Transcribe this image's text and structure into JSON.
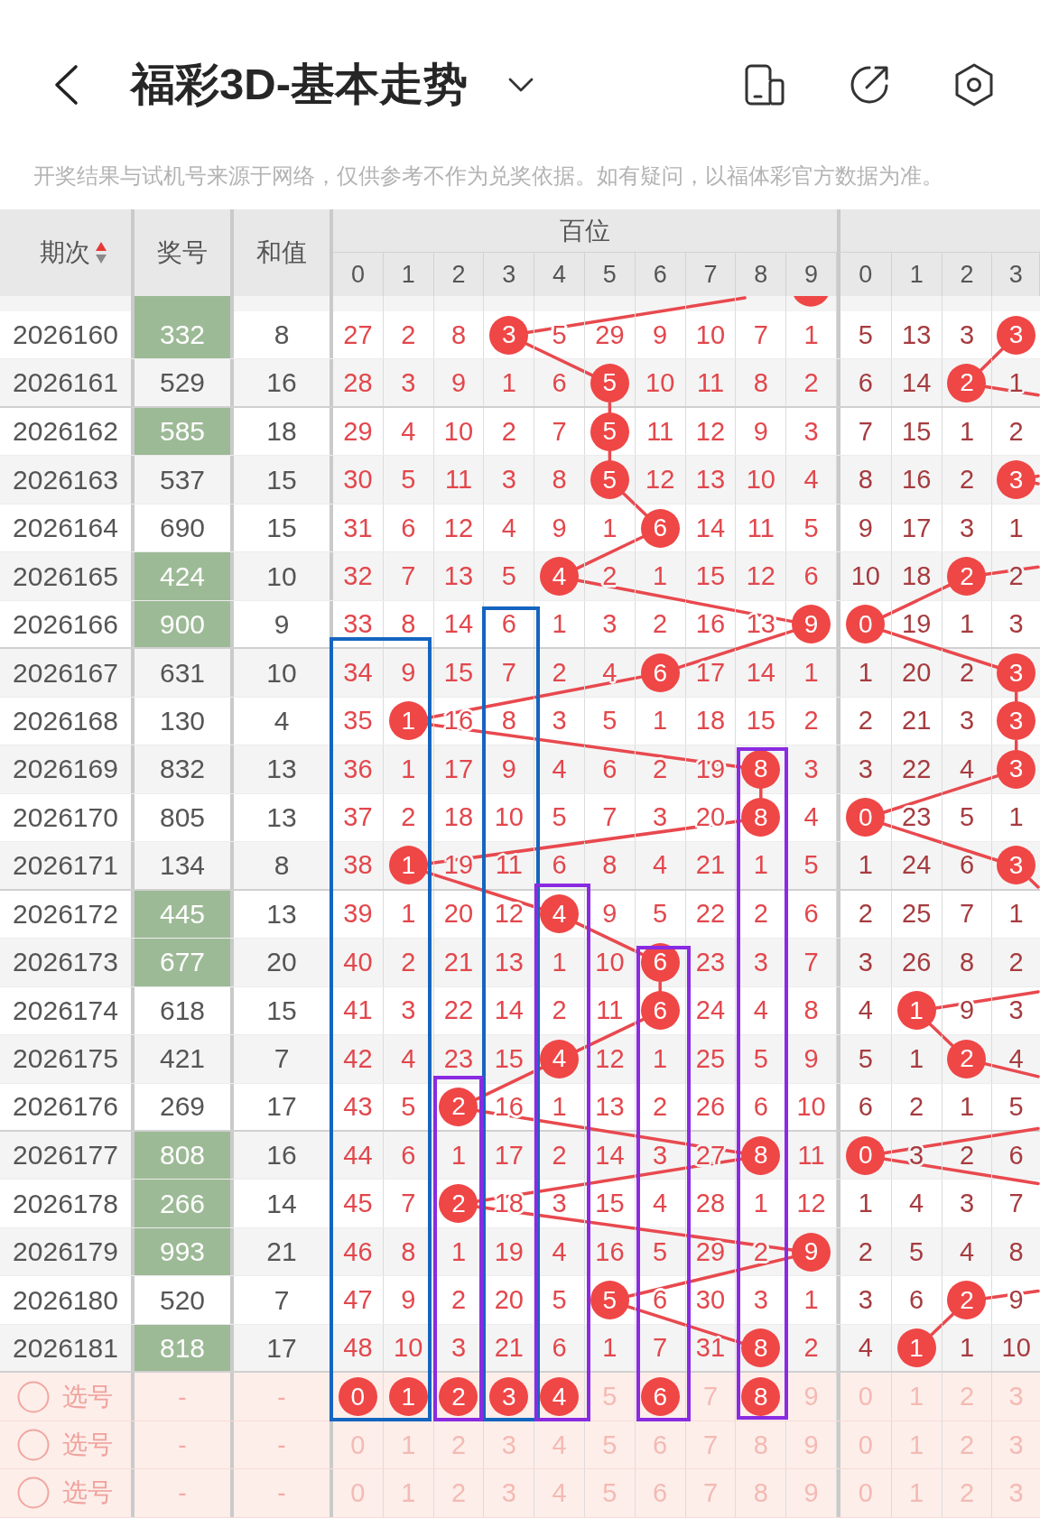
{
  "nav": {
    "title": "福彩3D-基本走势"
  },
  "notice": "开奖结果与试机号来源于网络，仅供参考不作为兑奖依据。如有疑问，以福体彩官方数据为准。",
  "table": {
    "columns": {
      "issue": "期次",
      "number": "奖号",
      "sum": "和值",
      "sort_ascending": true
    },
    "groups": [
      {
        "title": "百位",
        "digits": [
          "0",
          "1",
          "2",
          "3",
          "4",
          "5",
          "6",
          "7",
          "8",
          "9"
        ]
      },
      {
        "digits": [
          "0",
          "1",
          "2",
          "3"
        ]
      }
    ],
    "rows": [
      {
        "kind": "cut",
        "paired": true,
        "hundreds": [
          {
            "hit": false
          },
          {
            "hit": false
          },
          {
            "hit": false
          },
          {
            "hit": false
          },
          {
            "hit": false
          },
          {
            "hit": false
          },
          {
            "hit": false
          },
          {
            "hit": false
          },
          {
            "hit": false
          },
          {
            "hit": true
          }
        ]
      },
      {
        "kind": "draw",
        "issue": "2026160",
        "number": "332",
        "paired": true,
        "sum": "8",
        "hundreds": [
          {
            "text": "27",
            "hit": false
          },
          {
            "text": "2",
            "hit": false
          },
          {
            "text": "8",
            "hit": false
          },
          {
            "text": "3",
            "hit": true
          },
          {
            "text": "5",
            "hit": false
          },
          {
            "text": "29",
            "hit": false
          },
          {
            "text": "9",
            "hit": false
          },
          {
            "text": "10",
            "hit": false
          },
          {
            "text": "7",
            "hit": false
          },
          {
            "text": "1",
            "hit": false
          }
        ],
        "tens": [
          {
            "text": "5",
            "hit": false
          },
          {
            "text": "13",
            "hit": false
          },
          {
            "text": "3",
            "hit": false
          },
          {
            "text": "3",
            "hit": true
          }
        ]
      },
      {
        "kind": "draw",
        "issue": "2026161",
        "number": "529",
        "paired": false,
        "sum": "16",
        "hundreds": [
          {
            "text": "28",
            "hit": false
          },
          {
            "text": "3",
            "hit": false
          },
          {
            "text": "9",
            "hit": false
          },
          {
            "text": "1",
            "hit": false
          },
          {
            "text": "6",
            "hit": false
          },
          {
            "text": "5",
            "hit": true
          },
          {
            "text": "10",
            "hit": false
          },
          {
            "text": "11",
            "hit": false
          },
          {
            "text": "8",
            "hit": false
          },
          {
            "text": "2",
            "hit": false
          }
        ],
        "tens": [
          {
            "text": "6",
            "hit": false
          },
          {
            "text": "14",
            "hit": false
          },
          {
            "text": "2",
            "hit": true
          },
          {
            "text": "1",
            "hit": false
          }
        ]
      },
      {
        "kind": "draw",
        "issue": "2026162",
        "number": "585",
        "paired": true,
        "sum": "18",
        "hundreds": [
          {
            "text": "29",
            "hit": false
          },
          {
            "text": "4",
            "hit": false
          },
          {
            "text": "10",
            "hit": false
          },
          {
            "text": "2",
            "hit": false
          },
          {
            "text": "7",
            "hit": false
          },
          {
            "text": "5",
            "hit": true
          },
          {
            "text": "11",
            "hit": false
          },
          {
            "text": "12",
            "hit": false
          },
          {
            "text": "9",
            "hit": false
          },
          {
            "text": "3",
            "hit": false
          }
        ],
        "tens": [
          {
            "text": "7",
            "hit": false
          },
          {
            "text": "15",
            "hit": false
          },
          {
            "text": "1",
            "hit": false
          },
          {
            "text": "2",
            "hit": false
          }
        ]
      },
      {
        "kind": "draw",
        "issue": "2026163",
        "number": "537",
        "paired": false,
        "sum": "15",
        "hundreds": [
          {
            "text": "30",
            "hit": false
          },
          {
            "text": "5",
            "hit": false
          },
          {
            "text": "11",
            "hit": false
          },
          {
            "text": "3",
            "hit": false
          },
          {
            "text": "8",
            "hit": false
          },
          {
            "text": "5",
            "hit": true
          },
          {
            "text": "12",
            "hit": false
          },
          {
            "text": "13",
            "hit": false
          },
          {
            "text": "10",
            "hit": false
          },
          {
            "text": "4",
            "hit": false
          }
        ],
        "tens": [
          {
            "text": "8",
            "hit": false
          },
          {
            "text": "16",
            "hit": false
          },
          {
            "text": "2",
            "hit": false
          },
          {
            "text": "3",
            "hit": true
          }
        ]
      },
      {
        "kind": "draw",
        "issue": "2026164",
        "number": "690",
        "paired": false,
        "sum": "15",
        "hundreds": [
          {
            "text": "31",
            "hit": false
          },
          {
            "text": "6",
            "hit": false
          },
          {
            "text": "12",
            "hit": false
          },
          {
            "text": "4",
            "hit": false
          },
          {
            "text": "9",
            "hit": false
          },
          {
            "text": "1",
            "hit": false
          },
          {
            "text": "6",
            "hit": true
          },
          {
            "text": "14",
            "hit": false
          },
          {
            "text": "11",
            "hit": false
          },
          {
            "text": "5",
            "hit": false
          }
        ],
        "tens": [
          {
            "text": "9",
            "hit": false
          },
          {
            "text": "17",
            "hit": false
          },
          {
            "text": "3",
            "hit": false
          },
          {
            "text": "1",
            "hit": false
          }
        ]
      },
      {
        "kind": "draw",
        "issue": "2026165",
        "number": "424",
        "paired": true,
        "sum": "10",
        "hundreds": [
          {
            "text": "32",
            "hit": false
          },
          {
            "text": "7",
            "hit": false
          },
          {
            "text": "13",
            "hit": false
          },
          {
            "text": "5",
            "hit": false
          },
          {
            "text": "4",
            "hit": true
          },
          {
            "text": "2",
            "hit": false
          },
          {
            "text": "1",
            "hit": false
          },
          {
            "text": "15",
            "hit": false
          },
          {
            "text": "12",
            "hit": false
          },
          {
            "text": "6",
            "hit": false
          }
        ],
        "tens": [
          {
            "text": "10",
            "hit": false
          },
          {
            "text": "18",
            "hit": false
          },
          {
            "text": "2",
            "hit": true
          },
          {
            "text": "2",
            "hit": false
          }
        ]
      },
      {
        "kind": "draw",
        "issue": "2026166",
        "number": "900",
        "paired": true,
        "sum": "9",
        "hundreds": [
          {
            "text": "33",
            "hit": false
          },
          {
            "text": "8",
            "hit": false
          },
          {
            "text": "14",
            "hit": false
          },
          {
            "text": "6",
            "hit": false
          },
          {
            "text": "1",
            "hit": false
          },
          {
            "text": "3",
            "hit": false
          },
          {
            "text": "2",
            "hit": false
          },
          {
            "text": "16",
            "hit": false
          },
          {
            "text": "13",
            "hit": false
          },
          {
            "text": "9",
            "hit": true
          }
        ],
        "tens": [
          {
            "text": "0",
            "hit": true
          },
          {
            "text": "19",
            "hit": false
          },
          {
            "text": "1",
            "hit": false
          },
          {
            "text": "3",
            "hit": false
          }
        ]
      },
      {
        "kind": "draw",
        "issue": "2026167",
        "number": "631",
        "paired": false,
        "sum": "10",
        "hundreds": [
          {
            "text": "34",
            "hit": false
          },
          {
            "text": "9",
            "hit": false
          },
          {
            "text": "15",
            "hit": false
          },
          {
            "text": "7",
            "hit": false
          },
          {
            "text": "2",
            "hit": false
          },
          {
            "text": "4",
            "hit": false
          },
          {
            "text": "6",
            "hit": true
          },
          {
            "text": "17",
            "hit": false
          },
          {
            "text": "14",
            "hit": false
          },
          {
            "text": "1",
            "hit": false
          }
        ],
        "tens": [
          {
            "text": "1",
            "hit": false
          },
          {
            "text": "20",
            "hit": false
          },
          {
            "text": "2",
            "hit": false
          },
          {
            "text": "3",
            "hit": true
          }
        ]
      },
      {
        "kind": "draw",
        "issue": "2026168",
        "number": "130",
        "paired": false,
        "sum": "4",
        "hundreds": [
          {
            "text": "35",
            "hit": false
          },
          {
            "text": "1",
            "hit": true
          },
          {
            "text": "16",
            "hit": false
          },
          {
            "text": "8",
            "hit": false
          },
          {
            "text": "3",
            "hit": false
          },
          {
            "text": "5",
            "hit": false
          },
          {
            "text": "1",
            "hit": false
          },
          {
            "text": "18",
            "hit": false
          },
          {
            "text": "15",
            "hit": false
          },
          {
            "text": "2",
            "hit": false
          }
        ],
        "tens": [
          {
            "text": "2",
            "hit": false
          },
          {
            "text": "21",
            "hit": false
          },
          {
            "text": "3",
            "hit": false
          },
          {
            "text": "3",
            "hit": true
          }
        ]
      },
      {
        "kind": "draw",
        "issue": "2026169",
        "number": "832",
        "paired": false,
        "sum": "13",
        "hundreds": [
          {
            "text": "36",
            "hit": false
          },
          {
            "text": "1",
            "hit": false
          },
          {
            "text": "17",
            "hit": false
          },
          {
            "text": "9",
            "hit": false
          },
          {
            "text": "4",
            "hit": false
          },
          {
            "text": "6",
            "hit": false
          },
          {
            "text": "2",
            "hit": false
          },
          {
            "text": "19",
            "hit": false
          },
          {
            "text": "8",
            "hit": true
          },
          {
            "text": "3",
            "hit": false
          }
        ],
        "tens": [
          {
            "text": "3",
            "hit": false
          },
          {
            "text": "22",
            "hit": false
          },
          {
            "text": "4",
            "hit": false
          },
          {
            "text": "3",
            "hit": true
          }
        ]
      },
      {
        "kind": "draw",
        "issue": "2026170",
        "number": "805",
        "paired": false,
        "sum": "13",
        "hundreds": [
          {
            "text": "37",
            "hit": false
          },
          {
            "text": "2",
            "hit": false
          },
          {
            "text": "18",
            "hit": false
          },
          {
            "text": "10",
            "hit": false
          },
          {
            "text": "5",
            "hit": false
          },
          {
            "text": "7",
            "hit": false
          },
          {
            "text": "3",
            "hit": false
          },
          {
            "text": "20",
            "hit": false
          },
          {
            "text": "8",
            "hit": true
          },
          {
            "text": "4",
            "hit": false
          }
        ],
        "tens": [
          {
            "text": "0",
            "hit": true
          },
          {
            "text": "23",
            "hit": false
          },
          {
            "text": "5",
            "hit": false
          },
          {
            "text": "1",
            "hit": false
          }
        ]
      },
      {
        "kind": "draw",
        "issue": "2026171",
        "number": "134",
        "paired": false,
        "sum": "8",
        "hundreds": [
          {
            "text": "38",
            "hit": false
          },
          {
            "text": "1",
            "hit": true
          },
          {
            "text": "19",
            "hit": false
          },
          {
            "text": "11",
            "hit": false
          },
          {
            "text": "6",
            "hit": false
          },
          {
            "text": "8",
            "hit": false
          },
          {
            "text": "4",
            "hit": false
          },
          {
            "text": "21",
            "hit": false
          },
          {
            "text": "1",
            "hit": false
          },
          {
            "text": "5",
            "hit": false
          }
        ],
        "tens": [
          {
            "text": "1",
            "hit": false
          },
          {
            "text": "24",
            "hit": false
          },
          {
            "text": "6",
            "hit": false
          },
          {
            "text": "3",
            "hit": true
          }
        ]
      },
      {
        "kind": "draw",
        "issue": "2026172",
        "number": "445",
        "paired": true,
        "sum": "13",
        "hundreds": [
          {
            "text": "39",
            "hit": false
          },
          {
            "text": "1",
            "hit": false
          },
          {
            "text": "20",
            "hit": false
          },
          {
            "text": "12",
            "hit": false
          },
          {
            "text": "4",
            "hit": true
          },
          {
            "text": "9",
            "hit": false
          },
          {
            "text": "5",
            "hit": false
          },
          {
            "text": "22",
            "hit": false
          },
          {
            "text": "2",
            "hit": false
          },
          {
            "text": "6",
            "hit": false
          }
        ],
        "tens": [
          {
            "text": "2",
            "hit": false
          },
          {
            "text": "25",
            "hit": false
          },
          {
            "text": "7",
            "hit": false
          },
          {
            "text": "1",
            "hit": false
          }
        ]
      },
      {
        "kind": "draw",
        "issue": "2026173",
        "number": "677",
        "paired": true,
        "sum": "20",
        "hundreds": [
          {
            "text": "40",
            "hit": false
          },
          {
            "text": "2",
            "hit": false
          },
          {
            "text": "21",
            "hit": false
          },
          {
            "text": "13",
            "hit": false
          },
          {
            "text": "1",
            "hit": false
          },
          {
            "text": "10",
            "hit": false
          },
          {
            "text": "6",
            "hit": true
          },
          {
            "text": "23",
            "hit": false
          },
          {
            "text": "3",
            "hit": false
          },
          {
            "text": "7",
            "hit": false
          }
        ],
        "tens": [
          {
            "text": "3",
            "hit": false
          },
          {
            "text": "26",
            "hit": false
          },
          {
            "text": "8",
            "hit": false
          },
          {
            "text": "2",
            "hit": false
          }
        ]
      },
      {
        "kind": "draw",
        "issue": "2026174",
        "number": "618",
        "paired": false,
        "sum": "15",
        "hundreds": [
          {
            "text": "41",
            "hit": false
          },
          {
            "text": "3",
            "hit": false
          },
          {
            "text": "22",
            "hit": false
          },
          {
            "text": "14",
            "hit": false
          },
          {
            "text": "2",
            "hit": false
          },
          {
            "text": "11",
            "hit": false
          },
          {
            "text": "6",
            "hit": true
          },
          {
            "text": "24",
            "hit": false
          },
          {
            "text": "4",
            "hit": false
          },
          {
            "text": "8",
            "hit": false
          }
        ],
        "tens": [
          {
            "text": "4",
            "hit": false
          },
          {
            "text": "1",
            "hit": true
          },
          {
            "text": "9",
            "hit": false
          },
          {
            "text": "3",
            "hit": false
          }
        ]
      },
      {
        "kind": "draw",
        "issue": "2026175",
        "number": "421",
        "paired": false,
        "sum": "7",
        "hundreds": [
          {
            "text": "42",
            "hit": false
          },
          {
            "text": "4",
            "hit": false
          },
          {
            "text": "23",
            "hit": false
          },
          {
            "text": "15",
            "hit": false
          },
          {
            "text": "4",
            "hit": true
          },
          {
            "text": "12",
            "hit": false
          },
          {
            "text": "1",
            "hit": false
          },
          {
            "text": "25",
            "hit": false
          },
          {
            "text": "5",
            "hit": false
          },
          {
            "text": "9",
            "hit": false
          }
        ],
        "tens": [
          {
            "text": "5",
            "hit": false
          },
          {
            "text": "1",
            "hit": false
          },
          {
            "text": "2",
            "hit": true
          },
          {
            "text": "4",
            "hit": false
          }
        ]
      },
      {
        "kind": "draw",
        "issue": "2026176",
        "number": "269",
        "paired": false,
        "sum": "17",
        "hundreds": [
          {
            "text": "43",
            "hit": false
          },
          {
            "text": "5",
            "hit": false
          },
          {
            "text": "2",
            "hit": true
          },
          {
            "text": "16",
            "hit": false
          },
          {
            "text": "1",
            "hit": false
          },
          {
            "text": "13",
            "hit": false
          },
          {
            "text": "2",
            "hit": false
          },
          {
            "text": "26",
            "hit": false
          },
          {
            "text": "6",
            "hit": false
          },
          {
            "text": "10",
            "hit": false
          }
        ],
        "tens": [
          {
            "text": "6",
            "hit": false
          },
          {
            "text": "2",
            "hit": false
          },
          {
            "text": "1",
            "hit": false
          },
          {
            "text": "5",
            "hit": false
          }
        ]
      },
      {
        "kind": "draw",
        "issue": "2026177",
        "number": "808",
        "paired": true,
        "sum": "16",
        "hundreds": [
          {
            "text": "44",
            "hit": false
          },
          {
            "text": "6",
            "hit": false
          },
          {
            "text": "1",
            "hit": false
          },
          {
            "text": "17",
            "hit": false
          },
          {
            "text": "2",
            "hit": false
          },
          {
            "text": "14",
            "hit": false
          },
          {
            "text": "3",
            "hit": false
          },
          {
            "text": "27",
            "hit": false
          },
          {
            "text": "8",
            "hit": true
          },
          {
            "text": "11",
            "hit": false
          }
        ],
        "tens": [
          {
            "text": "0",
            "hit": true
          },
          {
            "text": "3",
            "hit": false
          },
          {
            "text": "2",
            "hit": false
          },
          {
            "text": "6",
            "hit": false
          }
        ]
      },
      {
        "kind": "draw",
        "issue": "2026178",
        "number": "266",
        "paired": true,
        "sum": "14",
        "hundreds": [
          {
            "text": "45",
            "hit": false
          },
          {
            "text": "7",
            "hit": false
          },
          {
            "text": "2",
            "hit": true
          },
          {
            "text": "18",
            "hit": false
          },
          {
            "text": "3",
            "hit": false
          },
          {
            "text": "15",
            "hit": false
          },
          {
            "text": "4",
            "hit": false
          },
          {
            "text": "28",
            "hit": false
          },
          {
            "text": "1",
            "hit": false
          },
          {
            "text": "12",
            "hit": false
          }
        ],
        "tens": [
          {
            "text": "1",
            "hit": false
          },
          {
            "text": "4",
            "hit": false
          },
          {
            "text": "3",
            "hit": false
          },
          {
            "text": "7",
            "hit": false
          }
        ]
      },
      {
        "kind": "draw",
        "issue": "2026179",
        "number": "993",
        "paired": true,
        "sum": "21",
        "hundreds": [
          {
            "text": "46",
            "hit": false
          },
          {
            "text": "8",
            "hit": false
          },
          {
            "text": "1",
            "hit": false
          },
          {
            "text": "19",
            "hit": false
          },
          {
            "text": "4",
            "hit": false
          },
          {
            "text": "16",
            "hit": false
          },
          {
            "text": "5",
            "hit": false
          },
          {
            "text": "29",
            "hit": false
          },
          {
            "text": "2",
            "hit": false
          },
          {
            "text": "9",
            "hit": true
          }
        ],
        "tens": [
          {
            "text": "2",
            "hit": false
          },
          {
            "text": "5",
            "hit": false
          },
          {
            "text": "4",
            "hit": false
          },
          {
            "text": "8",
            "hit": false
          }
        ]
      },
      {
        "kind": "draw",
        "issue": "2026180",
        "number": "520",
        "paired": false,
        "sum": "7",
        "hundreds": [
          {
            "text": "47",
            "hit": false
          },
          {
            "text": "9",
            "hit": false
          },
          {
            "text": "2",
            "hit": false
          },
          {
            "text": "20",
            "hit": false
          },
          {
            "text": "5",
            "hit": false
          },
          {
            "text": "5",
            "hit": true
          },
          {
            "text": "6",
            "hit": false
          },
          {
            "text": "30",
            "hit": false
          },
          {
            "text": "3",
            "hit": false
          },
          {
            "text": "1",
            "hit": false
          }
        ],
        "tens": [
          {
            "text": "3",
            "hit": false
          },
          {
            "text": "6",
            "hit": false
          },
          {
            "text": "2",
            "hit": true
          },
          {
            "text": "9",
            "hit": false
          }
        ]
      },
      {
        "kind": "draw",
        "issue": "2026181",
        "number": "818",
        "paired": true,
        "sum": "17",
        "hundreds": [
          {
            "text": "48",
            "hit": false
          },
          {
            "text": "10",
            "hit": false
          },
          {
            "text": "3",
            "hit": false
          },
          {
            "text": "21",
            "hit": false
          },
          {
            "text": "6",
            "hit": false
          },
          {
            "text": "1",
            "hit": false
          },
          {
            "text": "7",
            "hit": false
          },
          {
            "text": "31",
            "hit": false
          },
          {
            "text": "8",
            "hit": true
          },
          {
            "text": "2",
            "hit": false
          }
        ],
        "tens": [
          {
            "text": "4",
            "hit": false
          },
          {
            "text": "1",
            "hit": true
          },
          {
            "text": "1",
            "hit": false
          },
          {
            "text": "10",
            "hit": false
          }
        ]
      },
      {
        "kind": "pick",
        "checked": false,
        "label": "选号",
        "number": "-",
        "sum": "-",
        "hundreds": [
          {
            "text": "0",
            "selected": true
          },
          {
            "text": "1",
            "selected": true
          },
          {
            "text": "2",
            "selected": true
          },
          {
            "text": "3",
            "selected": true
          },
          {
            "text": "4",
            "selected": true
          },
          {
            "text": "5",
            "selected": false
          },
          {
            "text": "6",
            "selected": true
          },
          {
            "text": "7",
            "selected": false
          },
          {
            "text": "8",
            "selected": true
          },
          {
            "text": "9",
            "selected": false
          }
        ],
        "tens": [
          {
            "text": "0",
            "selected": false
          },
          {
            "text": "1",
            "selected": false
          },
          {
            "text": "2",
            "selected": false
          },
          {
            "text": "3",
            "selected": false
          }
        ]
      },
      {
        "kind": "pick",
        "checked": false,
        "label": "选号",
        "number": "-",
        "sum": "-",
        "hundreds": [
          {
            "text": "0",
            "selected": false
          },
          {
            "text": "1",
            "selected": false
          },
          {
            "text": "2",
            "selected": false
          },
          {
            "text": "3",
            "selected": false
          },
          {
            "text": "4",
            "selected": false
          },
          {
            "text": "5",
            "selected": false
          },
          {
            "text": "6",
            "selected": false
          },
          {
            "text": "7",
            "selected": false
          },
          {
            "text": "8",
            "selected": false
          },
          {
            "text": "9",
            "selected": false
          }
        ],
        "tens": [
          {
            "text": "0",
            "selected": false
          },
          {
            "text": "1",
            "selected": false
          },
          {
            "text": "2",
            "selected": false
          },
          {
            "text": "3",
            "selected": false
          }
        ]
      },
      {
        "kind": "pick",
        "checked": false,
        "label": "选号",
        "number": "-",
        "sum": "-",
        "hundreds": [
          {
            "text": "0",
            "selected": false
          },
          {
            "text": "1",
            "selected": false
          },
          {
            "text": "2",
            "selected": false
          },
          {
            "text": "3",
            "selected": false
          },
          {
            "text": "4",
            "selected": false
          },
          {
            "text": "5",
            "selected": false
          },
          {
            "text": "6",
            "selected": false
          },
          {
            "text": "7",
            "selected": false
          },
          {
            "text": "8",
            "selected": false
          },
          {
            "text": "9",
            "selected": false
          }
        ],
        "tens": [
          {
            "text": "0",
            "selected": false
          },
          {
            "text": "1",
            "selected": false
          },
          {
            "text": "2",
            "selected": false
          },
          {
            "text": "3",
            "selected": false
          }
        ]
      }
    ],
    "frames": [
      {
        "color": "#1565c0"
      },
      {
        "color": "#1565c0"
      },
      {
        "color": "#8a2be2"
      },
      {
        "color": "#8a2be2"
      },
      {
        "color": "#8a2be2"
      },
      {
        "color": "#8a2be2"
      }
    ]
  }
}
